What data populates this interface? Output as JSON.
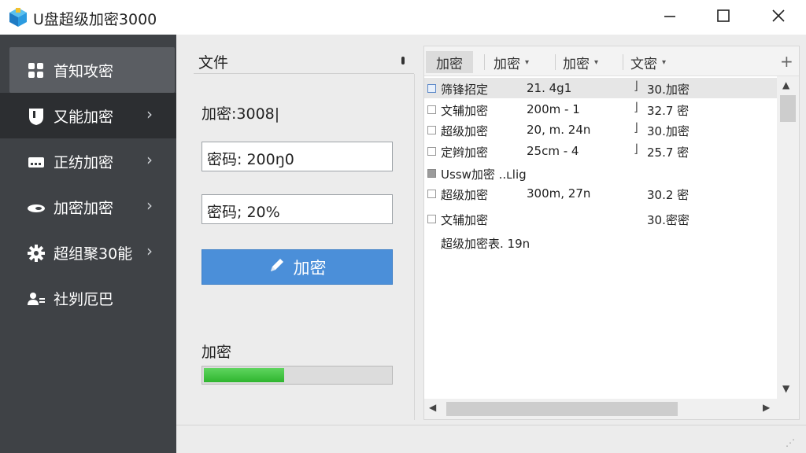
{
  "window": {
    "title": "U盘超级加密3000",
    "controls": {
      "minimize": "–",
      "maximize": "☐",
      "close": "✕"
    }
  },
  "sidebar": {
    "items": [
      {
        "label": "首知攻密",
        "icon": "grid-icon",
        "state": "active"
      },
      {
        "label": "又能加密",
        "icon": "shield-icon",
        "state": "selected",
        "chevron": "›"
      },
      {
        "label": "正纺加密",
        "icon": "drive-icon",
        "chevron": "›"
      },
      {
        "label": "加密加密",
        "icon": "link-icon",
        "chevron": "›"
      },
      {
        "label": "超组聚30能",
        "icon": "gear-icon",
        "chevron": "›"
      },
      {
        "label": "社刿厄巴",
        "icon": "users-icon"
      }
    ]
  },
  "middle": {
    "file_label": "文件",
    "encrypt_title": "加密:3008|",
    "password1": "密码: 200ŋ0",
    "password2": "密码; 20%",
    "encrypt_button": "加密",
    "progress_label": "加密",
    "progress": 0.43
  },
  "right": {
    "tabs": [
      {
        "label": "加密",
        "active": true
      },
      {
        "label": "加密",
        "caret": "▾"
      },
      {
        "label": "加密",
        "caret": "▾"
      },
      {
        "label": "文密",
        "caret": "▾"
      }
    ],
    "add_label": "+",
    "rows": [
      {
        "name": "筛锋招定",
        "size": "21. 4g1",
        "mark": "⌋",
        "status": "30.加密",
        "check": "checked",
        "highlight": true
      },
      {
        "name": "文辅加密",
        "size": "200m - 1",
        "mark": "⌋",
        "status": "32.7 密",
        "check": "empty"
      },
      {
        "name": "超级加密",
        "size": "20, m. 24n",
        "mark": "⌋",
        "status": "30.加密",
        "check": "empty"
      },
      {
        "name": "定辫加密",
        "size": "25cm - 4",
        "mark": "⌋",
        "status": "25.7 密",
        "check": "empty"
      },
      {
        "full": "Ussw加密 ..ʟlig",
        "check": "filled"
      },
      {
        "name": "超级加密",
        "size": "300m, 27n",
        "mark": "",
        "status": "30.2 密",
        "check": "empty"
      },
      {
        "name": "文辅加密",
        "size": "",
        "mark": "",
        "status": "30.密密",
        "check": "empty"
      },
      {
        "full": "超级加密表. 19n",
        "check": "none"
      }
    ]
  },
  "colors": {
    "sidebar_bg": "#3f4246",
    "button_blue": "#4b8fd9",
    "progress_green": "#2fb52f"
  }
}
